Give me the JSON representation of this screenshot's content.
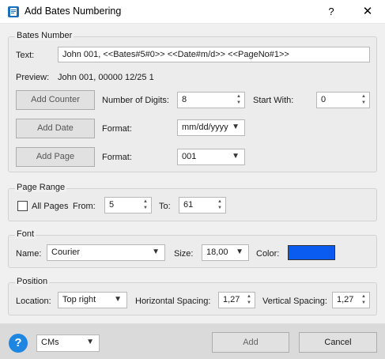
{
  "window": {
    "title": "Add Bates Numbering",
    "help_glyph": "?",
    "close_glyph": "✕",
    "app_icon": "bates-app-icon"
  },
  "bates_number": {
    "group_title": "Bates Number",
    "text_label": "Text:",
    "text_value": "John 001, <<Bates#5#0>> <<Date#m/d>> <<PageNo#1>>",
    "preview_label": "Preview:",
    "preview_value": "John 001, 00000 12/25 1",
    "add_counter_label": "Add Counter",
    "digits_label": "Number of Digits:",
    "digits_value": "8",
    "start_with_label": "Start With:",
    "start_with_value": "0",
    "add_date_label": "Add Date",
    "date_format_label": "Format:",
    "date_format_value": "mm/dd/yyyy",
    "add_page_label": "Add Page",
    "page_format_label": "Format:",
    "page_format_value": "001"
  },
  "page_range": {
    "group_title": "Page Range",
    "all_pages_label": "All Pages",
    "all_pages_checked": false,
    "from_label": "From:",
    "from_value": "5",
    "to_label": "To:",
    "to_value": "61"
  },
  "font": {
    "group_title": "Font",
    "name_label": "Name:",
    "name_value": "Courier",
    "size_label": "Size:",
    "size_value": "18,00",
    "color_label": "Color:",
    "color_value": "#0a5cf0"
  },
  "position": {
    "group_title": "Position",
    "location_label": "Location:",
    "location_value": "Top right",
    "h_spacing_label": "Horizontal Spacing:",
    "h_spacing_value": "1,27",
    "v_spacing_label": "Vertical Spacing:",
    "v_spacing_value": "1,27"
  },
  "footer": {
    "help_glyph": "?",
    "units_value": "CMs",
    "add_label": "Add",
    "cancel_label": "Cancel"
  },
  "colors": {
    "help_blue": "#1e86e0",
    "font_color_swatch": "#0a5cf0"
  }
}
